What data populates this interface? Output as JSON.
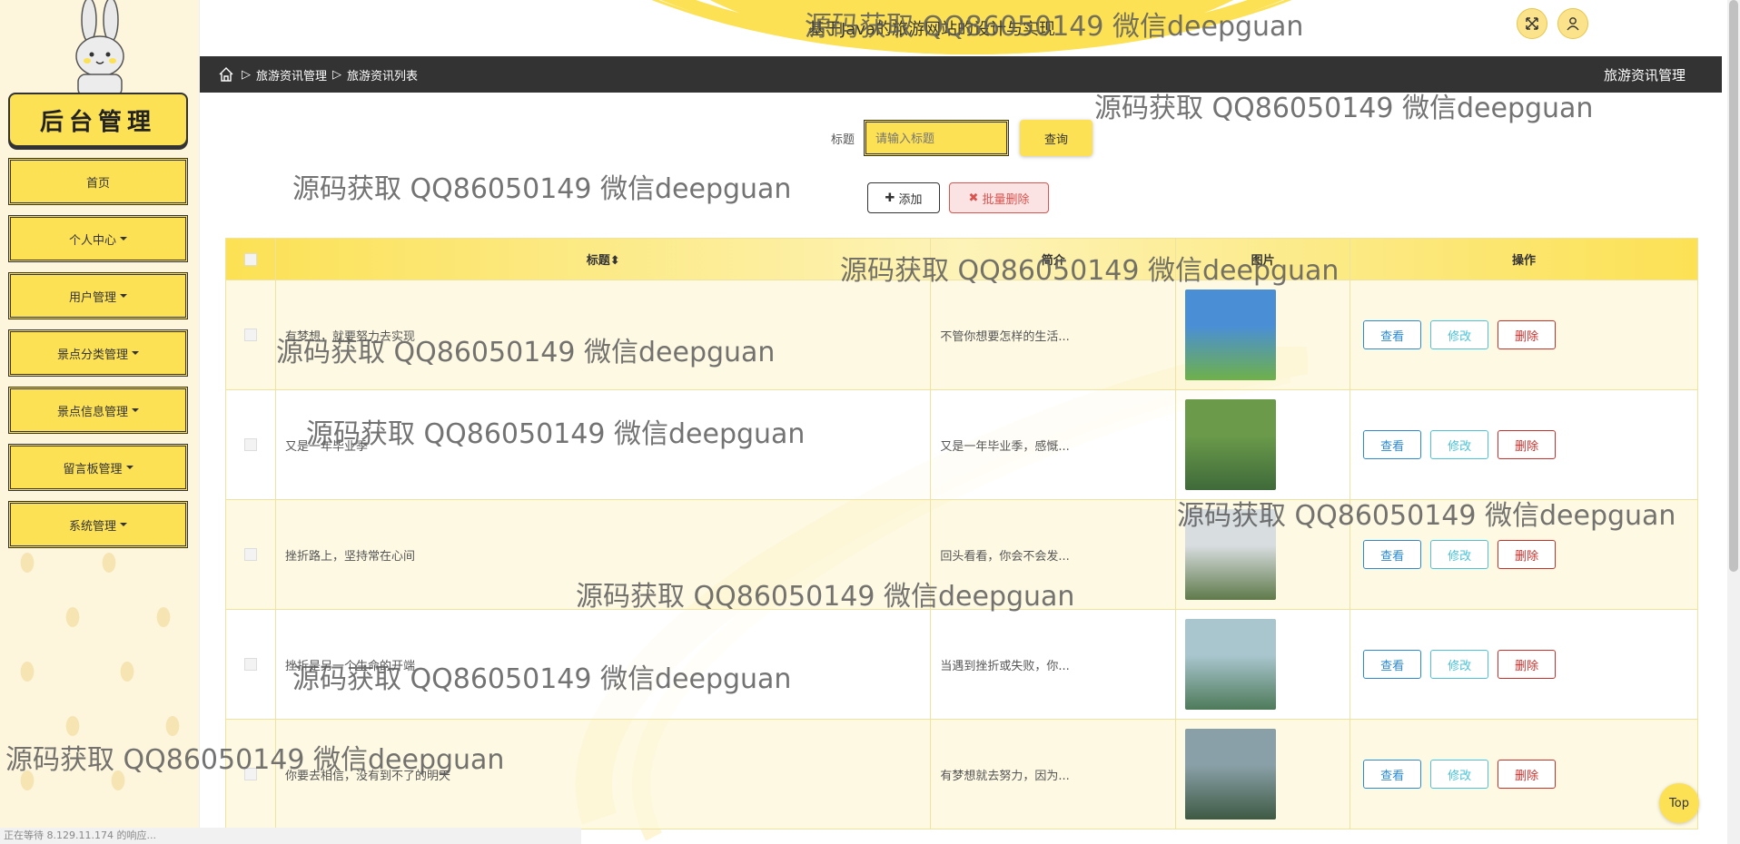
{
  "app": {
    "site_title": "基于Java的旅游网站的设计与实现",
    "logo_text": "后台管理"
  },
  "sidebar": {
    "items": [
      {
        "label": "首页"
      },
      {
        "label": "个人中心"
      },
      {
        "label": "用户管理"
      },
      {
        "label": "景点分类管理"
      },
      {
        "label": "景点信息管理"
      },
      {
        "label": "留言板管理"
      },
      {
        "label": "系统管理"
      }
    ]
  },
  "breadcrumb": {
    "items": [
      "旅游资讯管理",
      "旅游资讯列表"
    ],
    "right_title": "旅游资讯管理"
  },
  "search": {
    "label": "标题",
    "placeholder": "请输入标题",
    "button": "查询"
  },
  "actions": {
    "add": "添加",
    "batch_delete": "批量删除"
  },
  "table": {
    "headers": {
      "title": "标题",
      "intro": "简介",
      "image": "图片",
      "ops": "操作"
    },
    "op_labels": {
      "view": "查看",
      "edit": "修改",
      "delete": "删除"
    },
    "rows": [
      {
        "title": "有梦想，就要努力去实现",
        "intro": "不管你想要怎样的生活...",
        "image_colors": [
          "#4a8fd6",
          "#6fb04a"
        ]
      },
      {
        "title": "又是一年毕业季",
        "intro": "又是一年毕业季，感慨...",
        "image_colors": [
          "#6a9a4a",
          "#3f6a3a"
        ]
      },
      {
        "title": "挫折路上，坚持常在心间",
        "intro": "回头看看，你会不会发...",
        "image_colors": [
          "#d8dde0",
          "#5f7a4a"
        ]
      },
      {
        "title": "挫折是另一个生命的开端",
        "intro": "当遇到挫折或失败，你...",
        "image_colors": [
          "#a9c6cf",
          "#4e7a5a"
        ]
      },
      {
        "title": "你要去相信，没有到不了的明天",
        "intro": "有梦想就去努力，因为...",
        "image_colors": [
          "#8aa0a8",
          "#3e5a44"
        ]
      }
    ]
  },
  "watermarks": [
    "源码获取 QQ86050149 微信deepguan",
    "源码获取 QQ86050149 微信deepguan",
    "源码获取 QQ86050149 微信deepguan",
    "源码获取 QQ86050149 微信deepguan",
    "源码获取 QQ86050149 微信deepguan",
    "源码获取 QQ86050149 微信deepguan",
    "源码获取 QQ86050149 微信deepguan",
    "源码获取 QQ86050149 微信deepguan",
    "源码获取 QQ86050149 微信deepguan",
    "源码获取 QQ86050149 微信deepguan"
  ],
  "top_button": "Top",
  "status_text": "正在等待 8.129.11.174 的响应...",
  "colors": {
    "accent": "#fce154",
    "dark": "#333333",
    "danger": "#c9302c",
    "info": "#2b8ad1"
  },
  "icons": [
    "home-icon",
    "fullscreen-icon",
    "user-icon",
    "plus-icon",
    "close-icon",
    "sort-icon"
  ]
}
